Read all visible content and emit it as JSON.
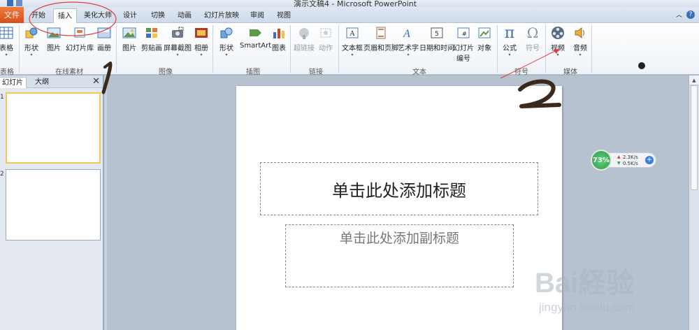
{
  "window": {
    "title": "演示文稿4 - Microsoft PowerPoint"
  },
  "tabs": {
    "file": "文件",
    "items": [
      "开始",
      "插入",
      "美化大师",
      "设计",
      "切换",
      "动画",
      "幻灯片放映",
      "审阅",
      "视图"
    ],
    "active": "插入"
  },
  "ribbon": {
    "groups": {
      "tables": {
        "label": "表格",
        "buttons": [
          "表格"
        ]
      },
      "online": {
        "label": "在线素材",
        "buttons": [
          "形状",
          "图片",
          "幻灯片库",
          "画册"
        ]
      },
      "images": {
        "label": "图像",
        "buttons": [
          "图片",
          "剪贴画",
          "屏幕截图",
          "相册"
        ]
      },
      "illustrations": {
        "label": "插图",
        "buttons": [
          "形状",
          "SmartArt",
          "图表"
        ]
      },
      "links": {
        "label": "链接",
        "buttons": [
          "超链接",
          "动作"
        ]
      },
      "text": {
        "label": "文本",
        "buttons": [
          "文本框",
          "页眉和页脚",
          "艺术字",
          "日期和时间",
          "幻灯片",
          "编号",
          "对象"
        ]
      },
      "symbols": {
        "label": "符号",
        "buttons": [
          "公式",
          "符号"
        ]
      },
      "media": {
        "label": "媒体",
        "buttons": [
          "视频",
          "音频"
        ]
      }
    }
  },
  "leftpane": {
    "tabs": [
      "幻灯片",
      "大纲"
    ],
    "close": "✕",
    "slides": [
      "1",
      "2"
    ]
  },
  "slide": {
    "title_placeholder": "单击此处添加标题",
    "subtitle_placeholder": "单击此处添加副标题"
  },
  "network": {
    "percent": "73%",
    "up": "2.3K/s",
    "down": "0.5K/s",
    "plus": "+"
  },
  "annotations": {
    "mark1": "1",
    "mark2": "2"
  },
  "watermark": {
    "logo": "Bai経验",
    "url": "jingyan.baidu.com"
  },
  "colors": {
    "file_tab": "#e0632a",
    "slide_selected": "#f4c95a",
    "annotation_red": "#e23b3b",
    "annotation_brown": "#3b2a1c"
  }
}
